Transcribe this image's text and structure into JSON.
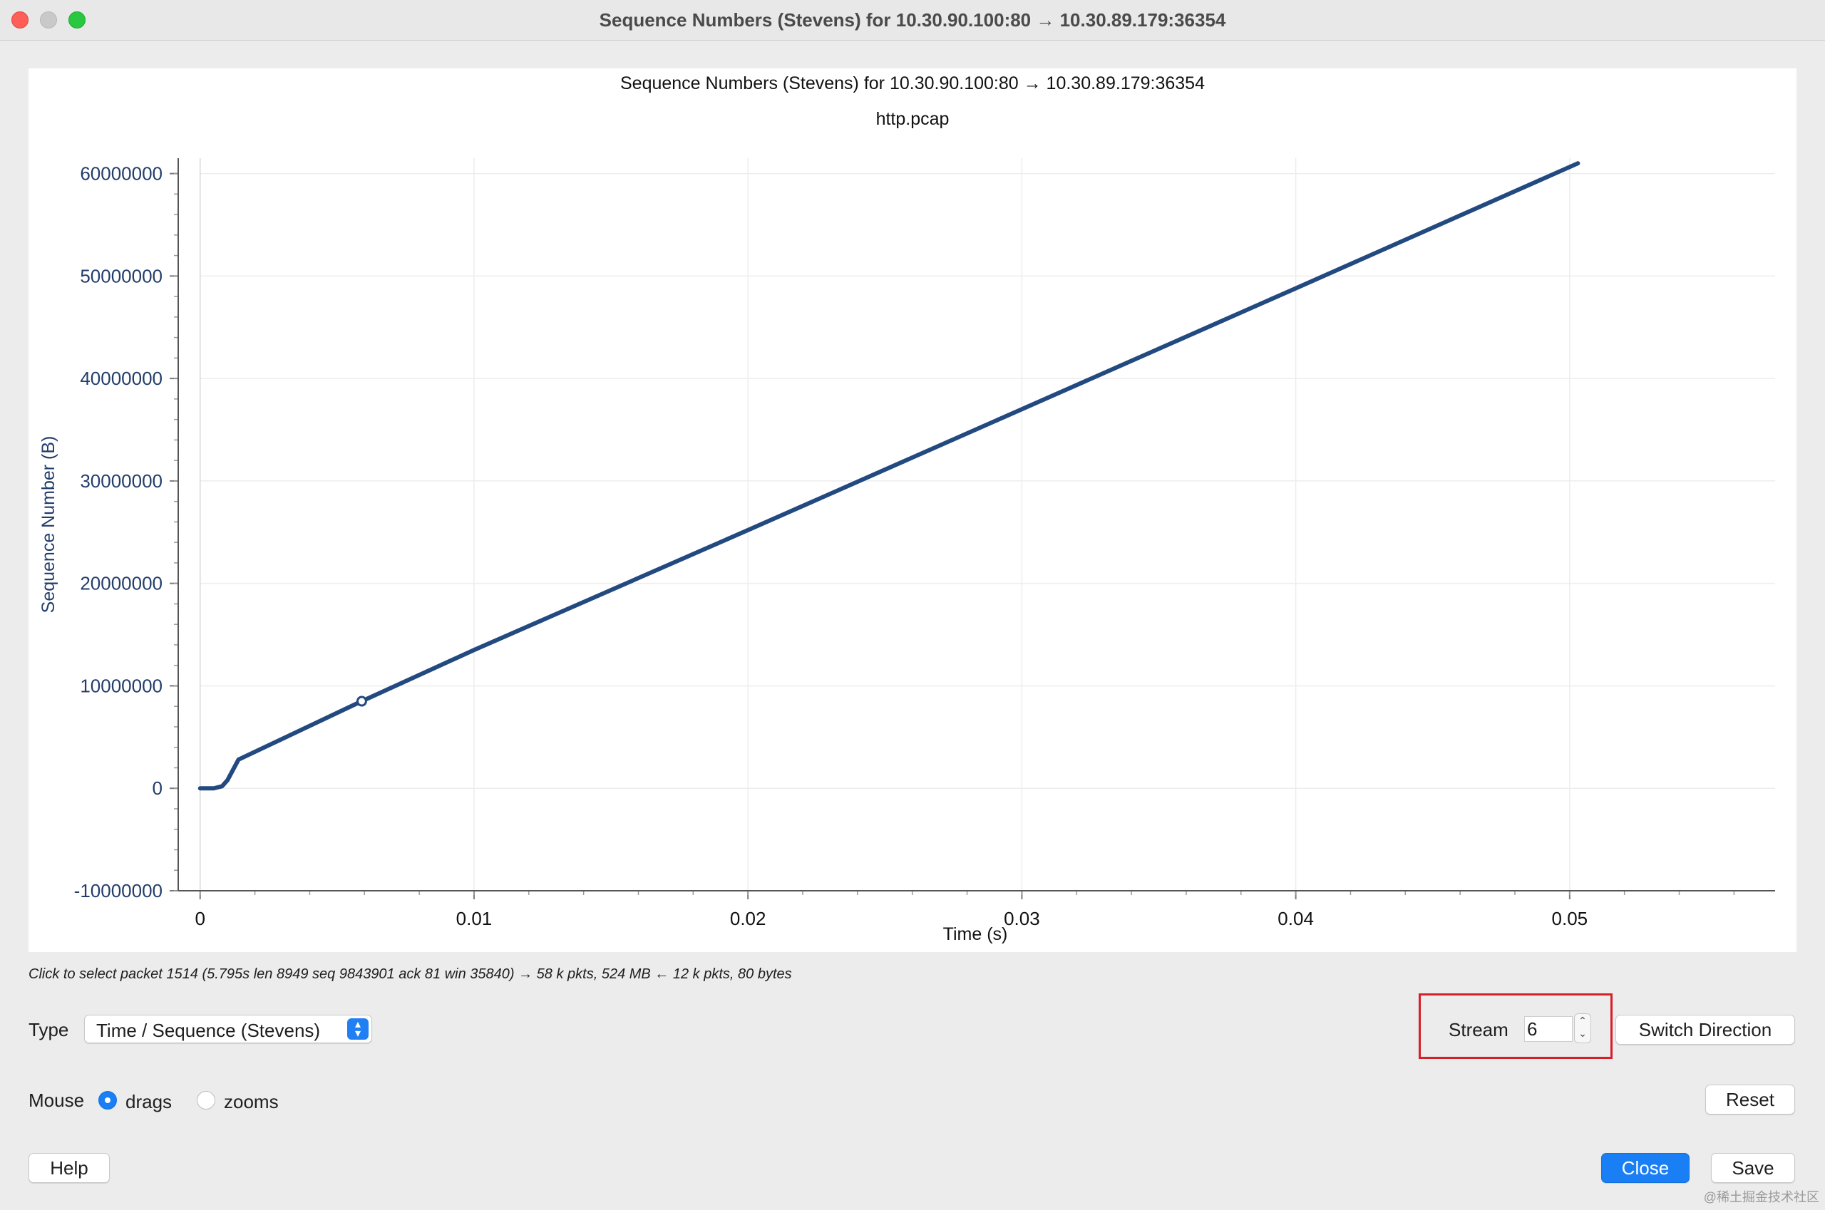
{
  "window": {
    "title": "Sequence Numbers (Stevens) for 10.30.90.100:80 → 10.30.89.179:36354"
  },
  "chart_data": {
    "type": "line",
    "title": "Sequence Numbers (Stevens) for 10.30.90.100:80 → 10.30.89.179:36354",
    "subtitle": "http.pcap",
    "xlabel": "Time (s)",
    "ylabel": "Sequence Number (B)",
    "xlim": [
      -0.0008,
      0.0575
    ],
    "ylim": [
      -10000000,
      61500000
    ],
    "x_ticks": [
      "0",
      "0.01",
      "0.02",
      "0.03",
      "0.04",
      "0.05"
    ],
    "y_ticks": [
      "60000000",
      "50000000",
      "40000000",
      "30000000",
      "20000000",
      "10000000",
      "0",
      "-10000000"
    ],
    "grid": true,
    "series_color": "#234a80",
    "series": [
      {
        "x": [
          0.0,
          0.0002,
          0.0005,
          0.0008,
          0.001,
          0.0014,
          0.0059,
          0.01,
          0.02,
          0.03,
          0.04,
          0.0503
        ],
        "y": [
          0,
          0,
          0,
          200000,
          800000,
          2800000,
          8500000,
          13500000,
          25200000,
          37000000,
          48800000,
          61000000
        ]
      }
    ],
    "selected_point": {
      "x": 0.0059,
      "y": 8500000
    }
  },
  "status": {
    "hint": "Click to select packet 1514 (5.795s len 8949 seq 9843901 ack 81 win 35840) → 58 k pkts, 524 MB ← 12 k pkts, 80 bytes"
  },
  "controls": {
    "type_label": "Type",
    "type_value": "Time / Sequence (Stevens)",
    "stream_label": "Stream",
    "stream_value": "6",
    "switch_direction": "Switch Direction",
    "mouse_label": "Mouse",
    "drags_label": "drags",
    "zooms_label": "zooms",
    "mouse_mode": "drags",
    "reset": "Reset",
    "help": "Help",
    "close": "Close",
    "save": "Save"
  },
  "watermark": "@稀土掘金技术社区",
  "colors": {
    "accent": "#1a7ff5",
    "highlight_box": "#d5202a",
    "axis_text": "#233d6b"
  }
}
